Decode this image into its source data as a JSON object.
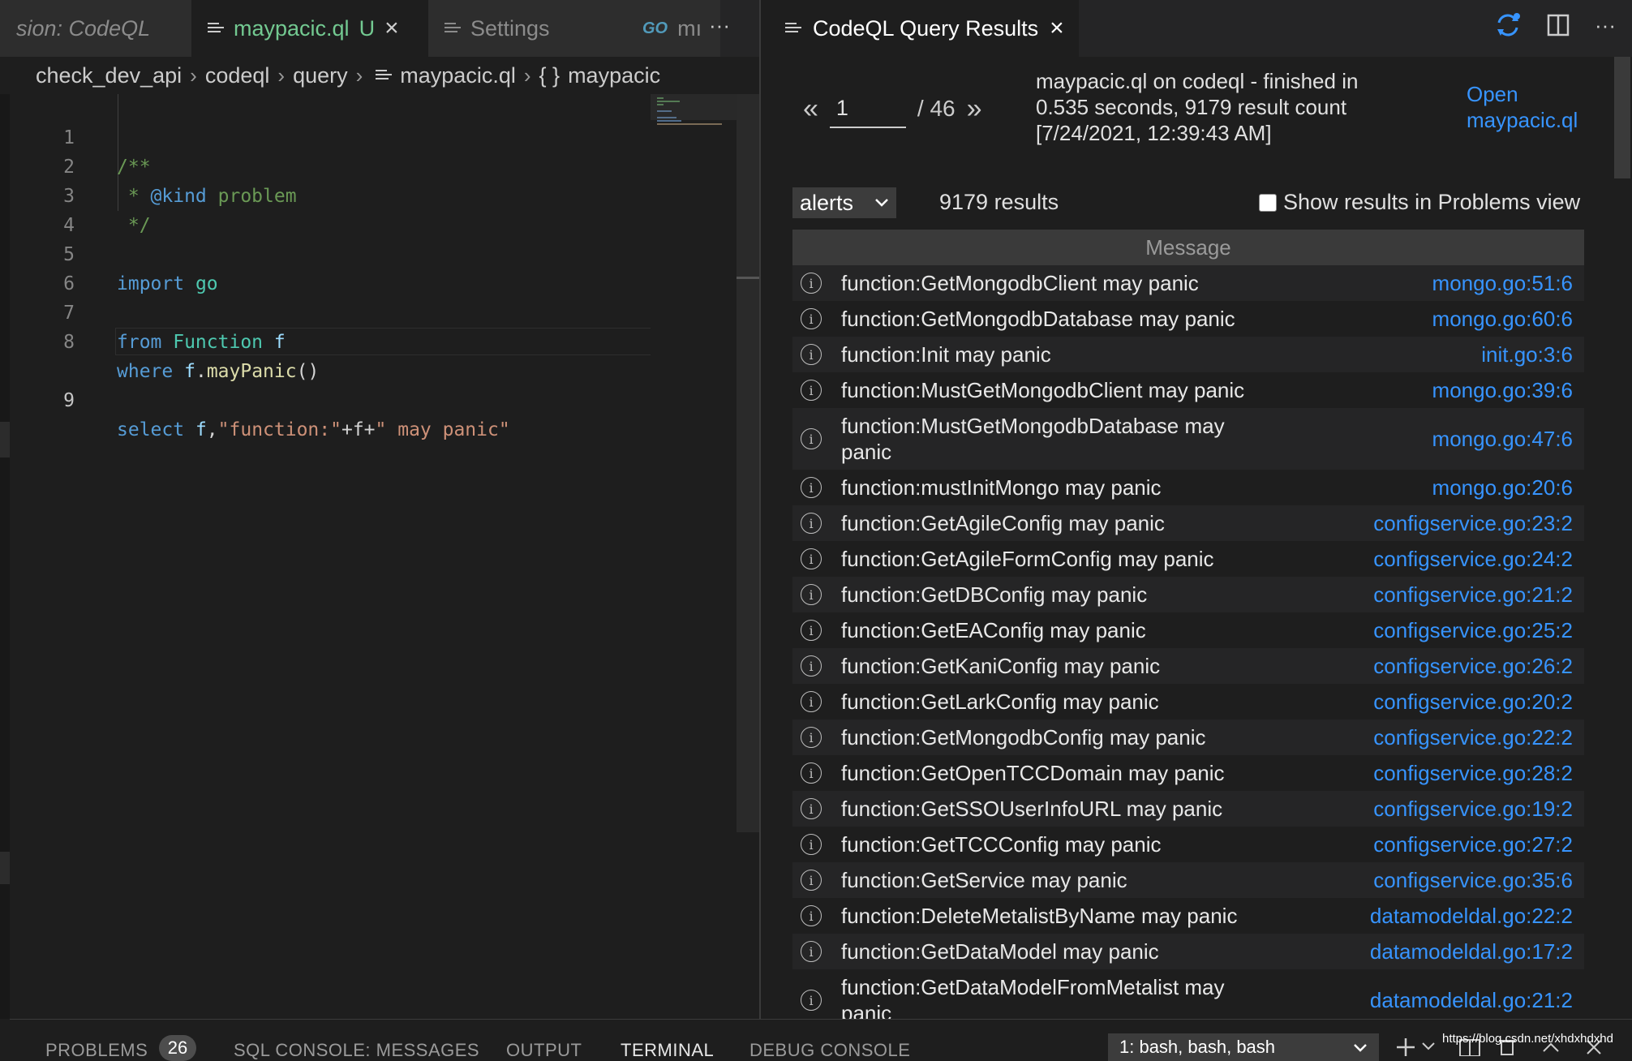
{
  "editor": {
    "tabs": [
      {
        "label": "sion: CodeQL"
      },
      {
        "label": "maypacic.ql",
        "status": "U"
      },
      {
        "label": "Settings"
      },
      {
        "label": "mı",
        "icon": "GO"
      }
    ],
    "more": "···",
    "breadcrumb": [
      "check_dev_api",
      "codeql",
      "query",
      "maypacic.ql",
      "maypacic"
    ],
    "braces_icon": "{ }",
    "separator": "›",
    "line_numbers": [
      "1",
      "2",
      "3",
      "4",
      "5",
      "6",
      "7",
      "8",
      "9"
    ],
    "code": {
      "l1": "/**",
      "l2_a": " * ",
      "l2_b": "@kind",
      "l2_c": " problem",
      "l3": " */",
      "l5_a": "import",
      "l5_b": " go",
      "l7_a": "from",
      "l7_b": " Function",
      "l7_c": " f",
      "l8_a": "where",
      "l8_b": " f",
      "l8_c": ".",
      "l8_d": "mayPanic",
      "l8_e": "()",
      "l9_a": "select",
      "l9_b": " f",
      "l9_c": ",",
      "l9_d": "\"function:\"",
      "l9_e": "+f+",
      "l9_f": "\" may panic\""
    }
  },
  "results": {
    "tab_title": "CodeQL Query Results",
    "prev": "«",
    "next": "»",
    "page": "1",
    "page_total": "/ 46",
    "info_line1": "maypacic.ql on codeql - finished in",
    "info_line2": "0.535 seconds, 9179 result count",
    "info_line3": "[7/24/2021, 12:39:43 AM]",
    "open_line1": "Open",
    "open_line2": "maypacic.ql",
    "result_set": "alerts",
    "count": "9179 results",
    "problems_label": "Show results in Problems view",
    "column_header": "Message",
    "rows": [
      {
        "msg": "function:GetMongodbClient may panic",
        "loc": "mongo.go:51:6"
      },
      {
        "msg": "function:GetMongodbDatabase may panic",
        "loc": "mongo.go:60:6"
      },
      {
        "msg": "function:Init may panic",
        "loc": "init.go:3:6"
      },
      {
        "msg": "function:MustGetMongodbClient may panic",
        "loc": "mongo.go:39:6"
      },
      {
        "msg": "function:MustGetMongodbDatabase may panic",
        "loc": "mongo.go:47:6"
      },
      {
        "msg": "function:mustInitMongo may panic",
        "loc": "mongo.go:20:6"
      },
      {
        "msg": "function:GetAgileConfig may panic",
        "loc": "configservice.go:23:2"
      },
      {
        "msg": "function:GetAgileFormConfig may panic",
        "loc": "configservice.go:24:2"
      },
      {
        "msg": "function:GetDBConfig may panic",
        "loc": "configservice.go:21:2"
      },
      {
        "msg": "function:GetEAConfig may panic",
        "loc": "configservice.go:25:2"
      },
      {
        "msg": "function:GetKaniConfig may panic",
        "loc": "configservice.go:26:2"
      },
      {
        "msg": "function:GetLarkConfig may panic",
        "loc": "configservice.go:20:2"
      },
      {
        "msg": "function:GetMongodbConfig may panic",
        "loc": "configservice.go:22:2"
      },
      {
        "msg": "function:GetOpenTCCDomain may panic",
        "loc": "configservice.go:28:2"
      },
      {
        "msg": "function:GetSSOUserInfoURL may panic",
        "loc": "configservice.go:19:2"
      },
      {
        "msg": "function:GetTCCConfig may panic",
        "loc": "configservice.go:27:2"
      },
      {
        "msg": "function:GetService may panic",
        "loc": "configservice.go:35:6"
      },
      {
        "msg": "function:DeleteMetalistByName may panic",
        "loc": "datamodeldal.go:22:2"
      },
      {
        "msg": "function:GetDataModel may panic",
        "loc": "datamodeldal.go:17:2"
      },
      {
        "msg": "function:GetDataModelFromMetalist may panic",
        "loc": "datamodeldal.go:21:2"
      }
    ]
  },
  "panel": {
    "tabs": [
      "PROBLEMS",
      "SQL CONSOLE: MESSAGES",
      "OUTPUT",
      "TERMINAL",
      "DEBUG CONSOLE"
    ],
    "problems_count": "26",
    "terminal_select": "1: bash, bash, bash",
    "watermark": "https://blog.csdn.net/xhdxhdxhd"
  },
  "colors": {
    "accent_link": "#3794ff",
    "modified_tab": "#73c991",
    "go_icon": "#519aba",
    "sync_icon": "#3794ff"
  },
  "icons": [
    "lines-icon",
    "close-icon",
    "go-icon",
    "more-icon",
    "braces-icon",
    "sync-icon",
    "split-editor-icon",
    "info-icon",
    "chevron-down-icon",
    "add-terminal-icon",
    "split-terminal-icon",
    "trash-icon",
    "maximize-icon"
  ]
}
